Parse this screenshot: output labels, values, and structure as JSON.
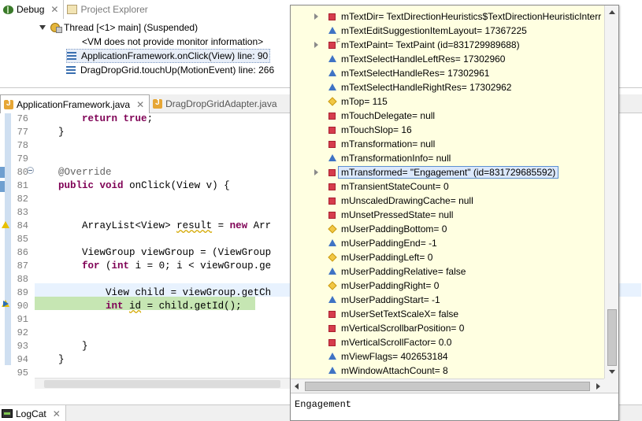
{
  "debug_view": {
    "tabs": [
      {
        "label": "Debug",
        "icon": "bug-icon",
        "active": true
      },
      {
        "label": "Project Explorer",
        "icon": "project-icon",
        "active": false
      }
    ],
    "tree": [
      {
        "kind": "thread",
        "text": "Thread [<1> main] (Suspended)"
      },
      {
        "kind": "info",
        "text": "<VM does not provide monitor information>"
      },
      {
        "kind": "frame",
        "text": "ApplicationFramework.onClick(View) line: 90",
        "selected": true
      },
      {
        "kind": "frame",
        "text": "DragDropGrid.touchUp(MotionEvent) line: 266"
      }
    ]
  },
  "editor": {
    "tabs": [
      {
        "label": "ApplicationFramework.java",
        "active": true
      },
      {
        "label": "DragDropGridAdapter.java",
        "active": false
      }
    ],
    "lines": [
      {
        "no": "76",
        "code": "        return true;"
      },
      {
        "no": "77",
        "code": "    }"
      },
      {
        "no": "78",
        "code": ""
      },
      {
        "no": "79",
        "code": ""
      },
      {
        "no": "80",
        "code": "    @Override"
      },
      {
        "no": "81",
        "code": "    public void onClick(View v) {"
      },
      {
        "no": "82",
        "code": ""
      },
      {
        "no": "83",
        "code": ""
      },
      {
        "no": "84",
        "code": "        ArrayList<View> result = new Arr"
      },
      {
        "no": "85",
        "code": ""
      },
      {
        "no": "86",
        "code": "        ViewGroup viewGroup = (ViewGroup"
      },
      {
        "no": "87",
        "code": "        for (int i = 0; i < viewGroup.ge"
      },
      {
        "no": "88",
        "code": ""
      },
      {
        "no": "89",
        "code": "            View child = viewGroup.getCh"
      },
      {
        "no": "90",
        "code": "            int id = child.getId();"
      },
      {
        "no": "91",
        "code": ""
      },
      {
        "no": "92",
        "code": ""
      },
      {
        "no": "93",
        "code": "        }"
      },
      {
        "no": "94",
        "code": "    }"
      },
      {
        "no": "95",
        "code": ""
      }
    ]
  },
  "logcat": {
    "tab_label": "LogCat"
  },
  "popup": {
    "variables": [
      {
        "text": "mTextDir= TextDirectionHeuristics$TextDirectionHeuristicInterr",
        "icon": "private",
        "expandable": true
      },
      {
        "text": "mTextEditSuggestionItemLayout= 17367225",
        "icon": "default",
        "expandable": false
      },
      {
        "text": "mTextPaint= TextPaint  (id=831729989688)",
        "icon": "private",
        "expandable": true,
        "final": true
      },
      {
        "text": "mTextSelectHandleLeftRes= 17302960",
        "icon": "default",
        "expandable": false
      },
      {
        "text": "mTextSelectHandleRes= 17302961",
        "icon": "default",
        "expandable": false
      },
      {
        "text": "mTextSelectHandleRightRes= 17302962",
        "icon": "default",
        "expandable": false
      },
      {
        "text": "mTop= 115",
        "icon": "protected",
        "expandable": false
      },
      {
        "text": "mTouchDelegate= null",
        "icon": "private",
        "expandable": false
      },
      {
        "text": "mTouchSlop= 16",
        "icon": "private",
        "expandable": false
      },
      {
        "text": "mTransformation= null",
        "icon": "private",
        "expandable": false
      },
      {
        "text": "mTransformationInfo= null",
        "icon": "default",
        "expandable": false
      },
      {
        "text": "mTransformed= \"Engagement\" (id=831729685592)",
        "icon": "private",
        "expandable": true,
        "selected": true
      },
      {
        "text": "mTransientStateCount= 0",
        "icon": "private",
        "expandable": false
      },
      {
        "text": "mUnscaledDrawingCache= null",
        "icon": "private",
        "expandable": false
      },
      {
        "text": "mUnsetPressedState= null",
        "icon": "private",
        "expandable": false
      },
      {
        "text": "mUserPaddingBottom= 0",
        "icon": "protected",
        "expandable": false
      },
      {
        "text": "mUserPaddingEnd= -1",
        "icon": "default",
        "expandable": false
      },
      {
        "text": "mUserPaddingLeft= 0",
        "icon": "protected",
        "expandable": false
      },
      {
        "text": "mUserPaddingRelative= false",
        "icon": "default",
        "expandable": false
      },
      {
        "text": "mUserPaddingRight= 0",
        "icon": "protected",
        "expandable": false
      },
      {
        "text": "mUserPaddingStart= -1",
        "icon": "default",
        "expandable": false
      },
      {
        "text": "mUserSetTextScaleX= false",
        "icon": "private",
        "expandable": false
      },
      {
        "text": "mVerticalScrollbarPosition= 0",
        "icon": "private",
        "expandable": false
      },
      {
        "text": "mVerticalScrollFactor= 0.0",
        "icon": "private",
        "expandable": false
      },
      {
        "text": "mViewFlags= 402653184",
        "icon": "default",
        "expandable": false
      },
      {
        "text": "mWindowAttachCount= 8",
        "icon": "default",
        "expandable": false
      }
    ],
    "detail_value": "Engagement"
  },
  "colors": {
    "popup_background": "#ffffe1",
    "keyword": "#7f0055",
    "execution_line": "#c6e6b3",
    "current_line": "#e8f2fe"
  }
}
